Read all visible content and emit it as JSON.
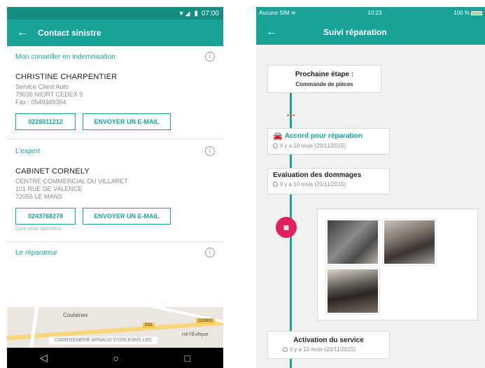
{
  "left_screen": {
    "status_time": "07:00",
    "title": "Contact sinistre",
    "conseiller": {
      "heading": "Mon conseiller en indemnisation",
      "name": "CHRISTINE CHARPENTIER",
      "lines": [
        "Service Client Auto",
        "79036 NIORT CEDEX 9",
        "Fax : 0549349304"
      ],
      "phone": "0228011212",
      "email_label": "ENVOYER UN E-MAIL"
    },
    "expert": {
      "heading": "L'expert",
      "name": "CABINET CORNELY",
      "lines": [
        "CENTRE COMMERCIAL DU VILLARET",
        "101 RUE DE VALENCE",
        "72055 LE MANS"
      ],
      "phone": "0243768278",
      "email_label": "ENVOYER UN E-MAIL",
      "note": "Coût selon opérateur"
    },
    "reparateur": {
      "heading": "Le réparateur",
      "map_town": "Coulaines",
      "map_road1": "D91",
      "map_road2": "D20BIS",
      "map_place": "rré-l'Évêque",
      "map_label": "CARROSSERIE ARNAUD D'ORLEANS LEC"
    },
    "nav": {
      "back": "◁",
      "home": "○",
      "recent": "□"
    }
  },
  "right_screen": {
    "carrier": "Aucune SIM",
    "time": "10:23",
    "battery": "100 %",
    "title": "Suivi réparation",
    "next_step": {
      "label": "Prochaine étape :",
      "value": "Commande de pièces"
    },
    "events": [
      {
        "title": "Accord pour réparation",
        "date": "Il y a 10 mois (20/11/2015)"
      },
      {
        "title": "Evaluation des dommages",
        "date": "Il y a 10 mois (20/11/2015)"
      },
      {
        "title": "Activation du service",
        "date": "Il y a 10 mois (20/11/2015)"
      }
    ]
  },
  "colors": {
    "teal": "#17a398",
    "pink": "#e0215d"
  }
}
